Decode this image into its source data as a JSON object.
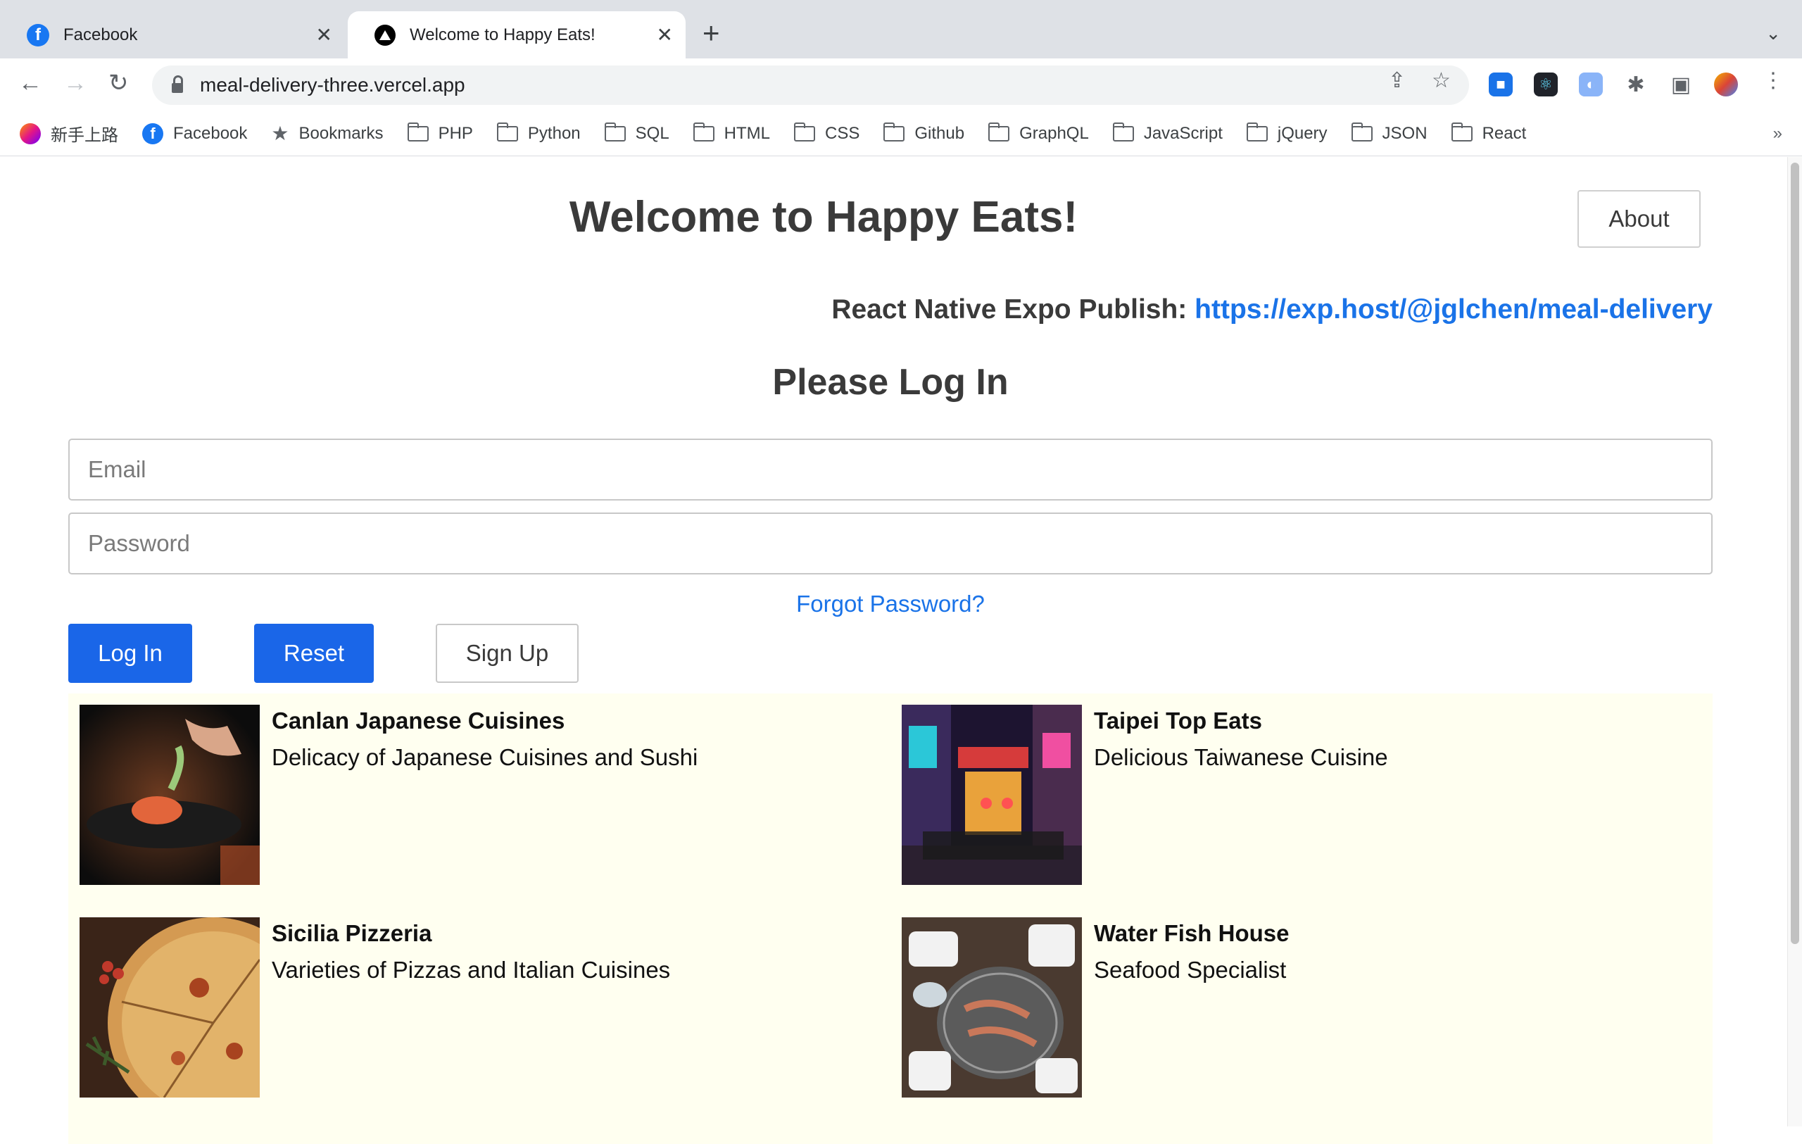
{
  "browser": {
    "tabs": [
      {
        "title": "Facebook",
        "active": false
      },
      {
        "title": "Welcome to Happy Eats!",
        "active": true
      }
    ],
    "url": "meal-delivery-three.vercel.app",
    "bookmarks": [
      {
        "label": "新手上路",
        "icon": "firefox-icon"
      },
      {
        "label": "Facebook",
        "icon": "facebook-icon"
      },
      {
        "label": "Bookmarks",
        "icon": "star-icon"
      },
      {
        "label": "PHP",
        "icon": "folder-icon"
      },
      {
        "label": "Python",
        "icon": "folder-icon"
      },
      {
        "label": "SQL",
        "icon": "folder-icon"
      },
      {
        "label": "HTML",
        "icon": "folder-icon"
      },
      {
        "label": "CSS",
        "icon": "folder-icon"
      },
      {
        "label": "Github",
        "icon": "folder-icon"
      },
      {
        "label": "GraphQL",
        "icon": "folder-icon"
      },
      {
        "label": "JavaScript",
        "icon": "folder-icon"
      },
      {
        "label": "jQuery",
        "icon": "folder-icon"
      },
      {
        "label": "JSON",
        "icon": "folder-icon"
      },
      {
        "label": "React",
        "icon": "folder-icon"
      }
    ]
  },
  "page": {
    "title": "Welcome to Happy Eats!",
    "about_label": "About",
    "expo_label": "React Native Expo Publish:",
    "expo_link": "https://exp.host/@jglchen/meal-delivery",
    "login_title": "Please Log In",
    "email_placeholder": "Email",
    "password_placeholder": "Password",
    "forgot_label": "Forgot Password?",
    "login_label": "Log In",
    "reset_label": "Reset",
    "signup_label": "Sign Up"
  },
  "restaurants": [
    {
      "name": "Canlan Japanese Cuisines",
      "description": "Delicacy of Japanese Cuisines and Sushi"
    },
    {
      "name": "Taipei Top Eats",
      "description": "Delicious Taiwanese Cuisine"
    },
    {
      "name": "Sicilia Pizzeria",
      "description": "Varieties of Pizzas and Italian Cuisines"
    },
    {
      "name": "Water Fish House",
      "description": "Seafood Specialist"
    }
  ],
  "colors": {
    "primary": "#1a66e8",
    "link": "#1a73e8",
    "grid_background": "#fffff0"
  }
}
